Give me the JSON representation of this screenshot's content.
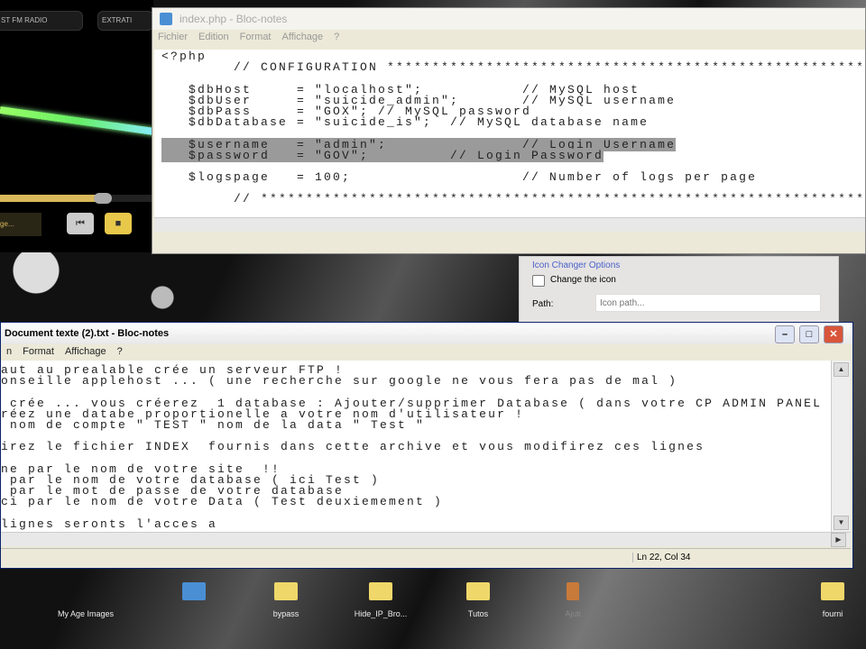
{
  "player": {
    "tabs": [
      "ST FM RADIO",
      "EXTRATI"
    ],
    "now_playing": "ge...",
    "progress": 0.65,
    "buttons": [
      "⏮",
      "■"
    ]
  },
  "back_window": {
    "title": "index.php - Bloc-notes",
    "menu": [
      "Fichier",
      "Edition",
      "Format",
      "Affichage",
      "?"
    ],
    "lines": [
      "<?php",
      "        // CONFIGURATION ************************************************************",
      "",
      "   $dbHost     = \"localhost\";           // MySQL host",
      "   $dbUser     = \"suicide_admin\";       // MySQL username",
      "   $dbPass     = \"GOX\"; // MySQL password",
      "   $dbDatabase = \"suicide_is\";  // MySQL database name",
      "",
      "   $username   = \"admin\";               // Login Username",
      "   $password   = \"GOV\";         // Login Password",
      "",
      "   $logspage   = 100;                   // Number of logs per page",
      "",
      "        // ***************************************************************************"
    ]
  },
  "icon_changer": {
    "title": "Icon Changer Options",
    "checkbox_label": "Change the icon",
    "checked": false,
    "path_label": "Path:",
    "path_placeholder": "Icon path..."
  },
  "front_window": {
    "title": "Document texte (2).txt - Bloc-notes",
    "menu": [
      "n",
      "Format",
      "Affichage",
      "?"
    ],
    "lines": [
      "aut au prealable crée un serveur FTP !",
      "onseille applehost ... ( une recherche sur google ne vous fera pas de mal )",
      "",
      " crée ... vous créerez  1 database : Ajouter/supprimer Database ( dans votre CP ADMIN PANEL )",
      "réez une databe proportionelle a votre nom d'utilisateur !",
      " nom de compte \" TEST \" nom de la data \" Test \"",
      "",
      "irez le fichier INDEX  fournis dans cette archive et vous modifirez ces lignes",
      "",
      "ne par le nom de votre site  !!",
      " par le nom de votre database ( ici Test )",
      " par le mot de passe de votre database",
      "ci par le nom de votre Data ( Test deuxiemement )",
      "",
      "lignes seronts l'acces a"
    ],
    "status": "Ln 22, Col 34"
  },
  "desktop_icons": [
    "My Age Images",
    "",
    "bypass",
    "Hide_IP_Bro...",
    "Tutos",
    "Ajuti",
    "fourni"
  ]
}
